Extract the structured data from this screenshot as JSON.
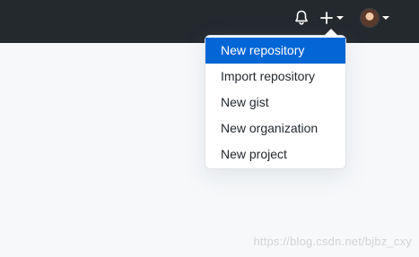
{
  "header": {
    "notifications_icon": "bell-icon",
    "create_icon": "plus-icon",
    "profile_icon": "avatar"
  },
  "dropdown": {
    "items": [
      {
        "label": "New repository",
        "active": true
      },
      {
        "label": "Import repository",
        "active": false
      },
      {
        "label": "New gist",
        "active": false
      },
      {
        "label": "New organization",
        "active": false
      },
      {
        "label": "New project",
        "active": false
      }
    ]
  },
  "watermark": "https://blog.csdn.net/bjbz_cxy",
  "colors": {
    "header_bg": "#24292e",
    "page_bg": "#f6f8fa",
    "active_item_bg": "#0366d6"
  }
}
